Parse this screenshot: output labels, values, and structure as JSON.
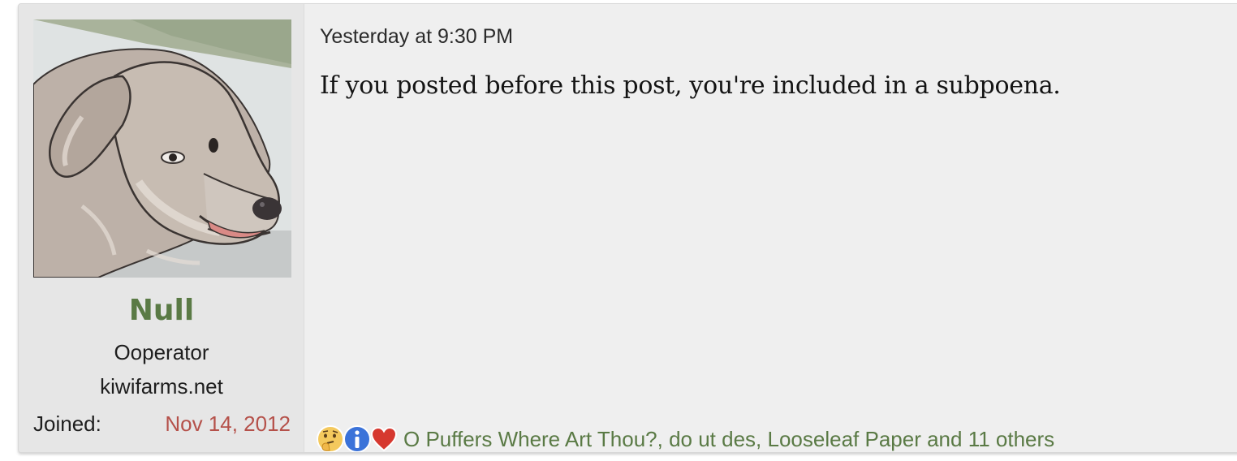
{
  "user": {
    "avatar_icon": "dog-avatar-icon",
    "name": "Null",
    "title": "Ooperator",
    "banner": "kiwifarms.net",
    "joined_label": "Joined:",
    "joined_date": "Nov 14, 2012"
  },
  "post": {
    "date": "Yesterday at 9:30 PM",
    "body": "If you posted before this post, you're included in a subpoena."
  },
  "reactions": {
    "icons": [
      "thinking-face-icon",
      "information-icon",
      "heart-icon"
    ],
    "text": "O Puffers Where Art Thou?, do ut des, Looseleaf Paper and 11 others"
  },
  "colors": {
    "username": "#5a7a45",
    "joined_date": "#b5514a",
    "reaction_link": "#5a7a45",
    "post_background": "#efefef",
    "user_cell_background": "#e6e6e6"
  }
}
